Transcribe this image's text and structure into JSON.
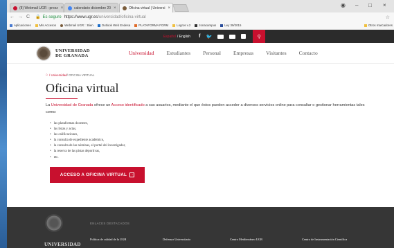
{
  "browser": {
    "tabs": [
      {
        "label": "(8) Webmail UGR : prezz",
        "close": "×"
      },
      {
        "label": "calendario diciembre 20",
        "close": "×"
      },
      {
        "label": "Oficina virtual | Universi",
        "close": "×"
      }
    ],
    "window_controls": {
      "minimize": "–",
      "maximize": "□",
      "close": "×"
    },
    "address": {
      "secure_label": "Es seguro",
      "url_host": "https://www.ugr.es",
      "url_path": "/universidad/oficina-virtual"
    },
    "bookmarks": [
      "Aplicaciones",
      "Mis Accesos",
      "Webmail UGR :: Bien",
      "Outlook Web Endesa",
      "PLATAFORMA FORM",
      "Logros v.2",
      "zonacampus",
      "Ley 39/2015"
    ],
    "bookmarks_other": "Otros marcadores"
  },
  "site": {
    "topbar": {
      "lang_active": "Español",
      "lang_other": " / English"
    },
    "logo": {
      "line1": "UNIVERSIDAD",
      "line2": "DE GRANADA"
    },
    "nav": [
      "Universidad",
      "Estudiantes",
      "Personal",
      "Empresas",
      "Visitantes",
      "Contacto"
    ],
    "breadcrumb": {
      "link": "/ Universidad",
      "current": " / OFICINA VIRTUAL"
    },
    "title": "Oficina virtual",
    "intro": {
      "p1": "La ",
      "link1": "Universidad de Granada",
      "p2": " ofrece un ",
      "link2": "Acceso identificado",
      "p3": " a sus usuarios, mediante el que éstos pueden acceder a diversos servicios online para consultar o gestionar herramientas tales como:"
    },
    "list": [
      "las plataformas docentes,",
      "las listas y actas,",
      "las calificaciones,",
      "la consulta de expediente académico,",
      "la consulta de las nóminas, el portal del investigador,",
      "la reserva de las pistas deportivas,",
      "etc."
    ],
    "cta": "ACCESO A OFICINA VIRTUAL",
    "footer": {
      "heading": "ENLACES DESTACADOS",
      "logo_text": "UNIVERSIDAD",
      "links": [
        "Política de calidad de la UGR",
        "Defensor Universitario",
        "Centro Mediterráneo UGR",
        "Centro de Instrumentación Científica"
      ]
    }
  }
}
